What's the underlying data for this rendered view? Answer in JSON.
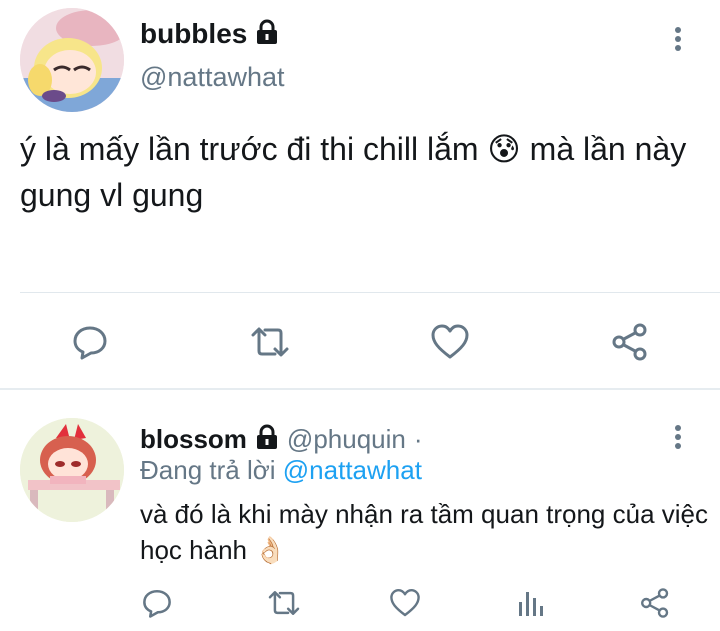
{
  "main_tweet": {
    "display_name": "bubbles",
    "handle": "@nattawhat",
    "text": "ý là mấy lần trước đi thi chill lắm",
    "emoji": "😰",
    "text_after_emoji": " mà lần này gung vl gung",
    "icons": {
      "reply": "reply-icon",
      "retweet": "retweet-icon",
      "like": "heart-icon",
      "share": "share-icon",
      "more": "more-vertical-icon",
      "lock": "lock-icon"
    }
  },
  "reply_tweet": {
    "display_name": "blossom",
    "handle": "@phuquin",
    "separator": "·",
    "replying_to_label": "Đang trả lời ",
    "replying_to_handle": "@nattawhat",
    "text": "và đó là khi mày nhận ra tầm quan trọng của việc học hành",
    "emoji": "👌🏻",
    "icons": {
      "reply": "reply-icon",
      "retweet": "retweet-icon",
      "like": "heart-icon",
      "analytics": "analytics-icon",
      "share": "share-icon"
    }
  },
  "colors": {
    "text": "#14171a",
    "secondary": "#657786",
    "accent": "#1da1f2",
    "divider": "#e1e8ed"
  }
}
